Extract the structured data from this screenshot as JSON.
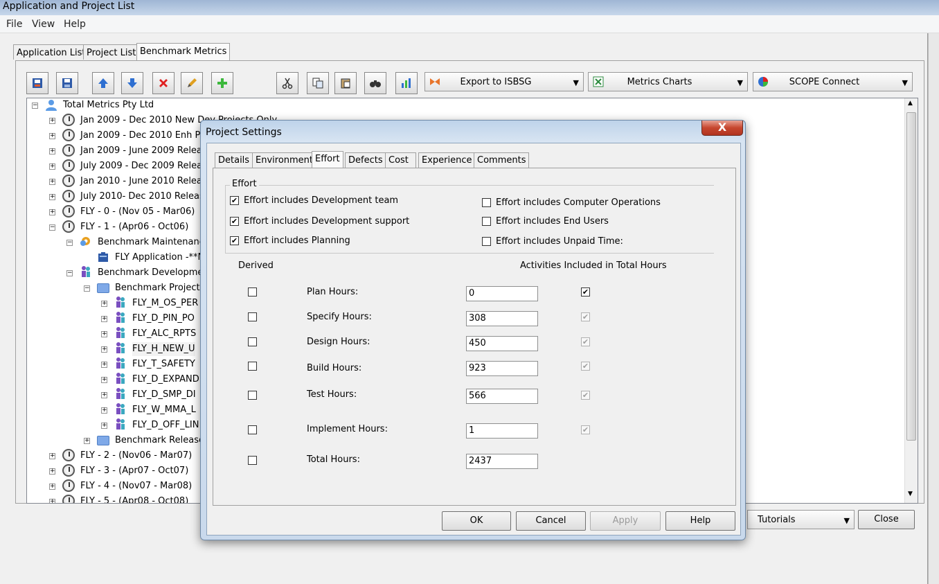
{
  "window": {
    "title": "Application and Project List"
  },
  "menu": [
    "File",
    "View",
    "Help"
  ],
  "main_tabs": [
    "Application List",
    "Project List",
    "Benchmark Metrics"
  ],
  "toolbar": {
    "export_label": "Export to ISBSG",
    "charts_label": "Metrics Charts",
    "scope_label": "SCOPE Connect"
  },
  "tree": {
    "root": "Total Metrics Pty Ltd",
    "items": [
      "Jan 2009 - Dec 2010 New Dev Projects Only",
      "Jan 2009 - Dec 2010 Enh Proj",
      "Jan 2009 - June 2009 Release",
      "July 2009 - Dec 2009 Release",
      "Jan 2010 - June 2010 Release",
      "July 2010- Dec 2010 Release",
      "FLY - 0 - (Nov 05 - Mar06)",
      "FLY - 1 - (Apr06 - Oct06)",
      "Benchmark Maintenance",
      "FLY Application -**N",
      "Benchmark Developmen",
      "Benchmark Projects",
      "FLY_M_OS_PER",
      "FLY_D_PIN_PO",
      "FLY_ALC_RPTS",
      "FLY_H_NEW_U",
      "FLY_T_SAFETY",
      "FLY_D_EXPAND",
      "FLY_D_SMP_DI",
      "FLY_W_MMA_L",
      "FLY_D_OFF_LIN",
      "Benchmark Release",
      "FLY - 2 - (Nov06 - Mar07)",
      "FLY - 3 - (Apr07 - Oct07)",
      "FLY - 4 - (Nov07 - Mar08)",
      "FLY - 5 - (Apr08 - Oct08)"
    ]
  },
  "bottom": {
    "tutorials_label": "Tutorials",
    "close_label": "Close"
  },
  "dialog": {
    "title": "Project Settings",
    "close_glyph": "X",
    "tabs": [
      "Details",
      "Environment",
      "Effort",
      "Defects",
      "Cost",
      "Experience",
      "Comments"
    ],
    "group_label": "Effort",
    "checks_left": [
      {
        "label": "Effort includes Development team",
        "checked": true
      },
      {
        "label": "Effort includes Development support",
        "checked": true
      },
      {
        "label": "Effort includes Planning",
        "checked": true
      }
    ],
    "checks_right": [
      {
        "label": "Effort includes Computer Operations",
        "checked": false
      },
      {
        "label": "Effort includes End Users",
        "checked": false
      },
      {
        "label": "Effort includes Unpaid Time:",
        "checked": false
      }
    ],
    "derived_label": "Derived",
    "activities_label": "Activities Included in Total Hours",
    "hours": [
      {
        "label": "Plan Hours:",
        "value": "0",
        "included": true
      },
      {
        "label": "Specify Hours:",
        "value": "308",
        "included": true
      },
      {
        "label": "Design Hours:",
        "value": "450",
        "included": true
      },
      {
        "label": "Build Hours:",
        "value": "923",
        "included": true
      },
      {
        "label": "Test Hours:",
        "value": "566",
        "included": true
      },
      {
        "label": "Implement Hours:",
        "value": "1",
        "included": true
      },
      {
        "label": "Total Hours:",
        "value": "2437"
      }
    ],
    "buttons": {
      "ok": "OK",
      "cancel": "Cancel",
      "apply": "Apply",
      "help": "Help"
    }
  }
}
